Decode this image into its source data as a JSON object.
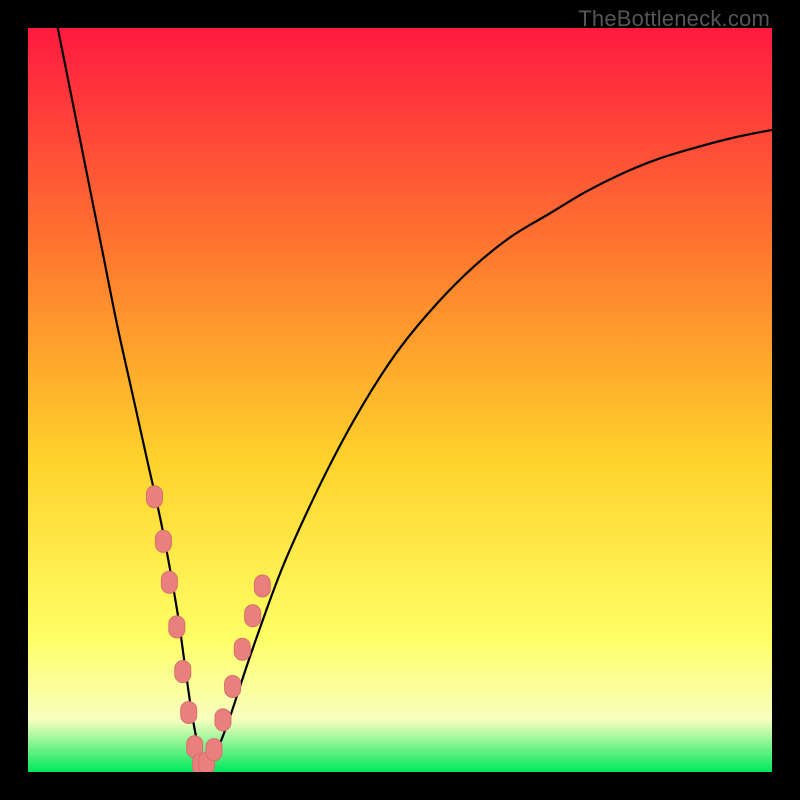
{
  "watermark": "TheBottleneck.com",
  "colors": {
    "frame": "#000000",
    "curve": "#000000",
    "marker_fill": "#e9807e",
    "marker_stroke": "#d86f6c",
    "grad_top": "#ff1a40",
    "grad_mid_upper": "#ff7e2e",
    "grad_mid": "#ffd22b",
    "grad_mid_lower": "#ffff66",
    "grad_band": "#f7ffbf",
    "grad_bottom": "#00e85b"
  },
  "chart_data": {
    "type": "line",
    "title": "",
    "xlabel": "",
    "ylabel": "",
    "xlim": [
      0,
      100
    ],
    "ylim": [
      0,
      100
    ],
    "grid": false,
    "legend": false,
    "series": [
      {
        "name": "bottleneck-curve",
        "x": [
          4,
          6,
          8,
          10,
          12,
          14,
          16,
          18,
          20,
          21,
          22,
          23,
          24,
          25,
          27,
          30,
          34,
          38,
          42,
          46,
          50,
          55,
          60,
          65,
          70,
          75,
          80,
          85,
          90,
          95,
          100
        ],
        "y": [
          100,
          90,
          80,
          70,
          60,
          51,
          42,
          33,
          22,
          15,
          8,
          3,
          1,
          2,
          7,
          16,
          27,
          36,
          44,
          51,
          57,
          63,
          68,
          72,
          75,
          78,
          80.5,
          82.5,
          84,
          85.3,
          86.3
        ]
      }
    ],
    "markers": {
      "name": "sample-points",
      "x": [
        17.0,
        18.2,
        19.0,
        20.0,
        20.8,
        21.6,
        22.4,
        23.2,
        24.0,
        25.0,
        26.2,
        27.5,
        28.8,
        30.2,
        31.5
      ],
      "y": [
        37.0,
        31.0,
        25.5,
        19.5,
        13.5,
        8.0,
        3.4,
        1.0,
        1.2,
        3.0,
        7.0,
        11.5,
        16.5,
        21.0,
        25.0
      ]
    }
  }
}
